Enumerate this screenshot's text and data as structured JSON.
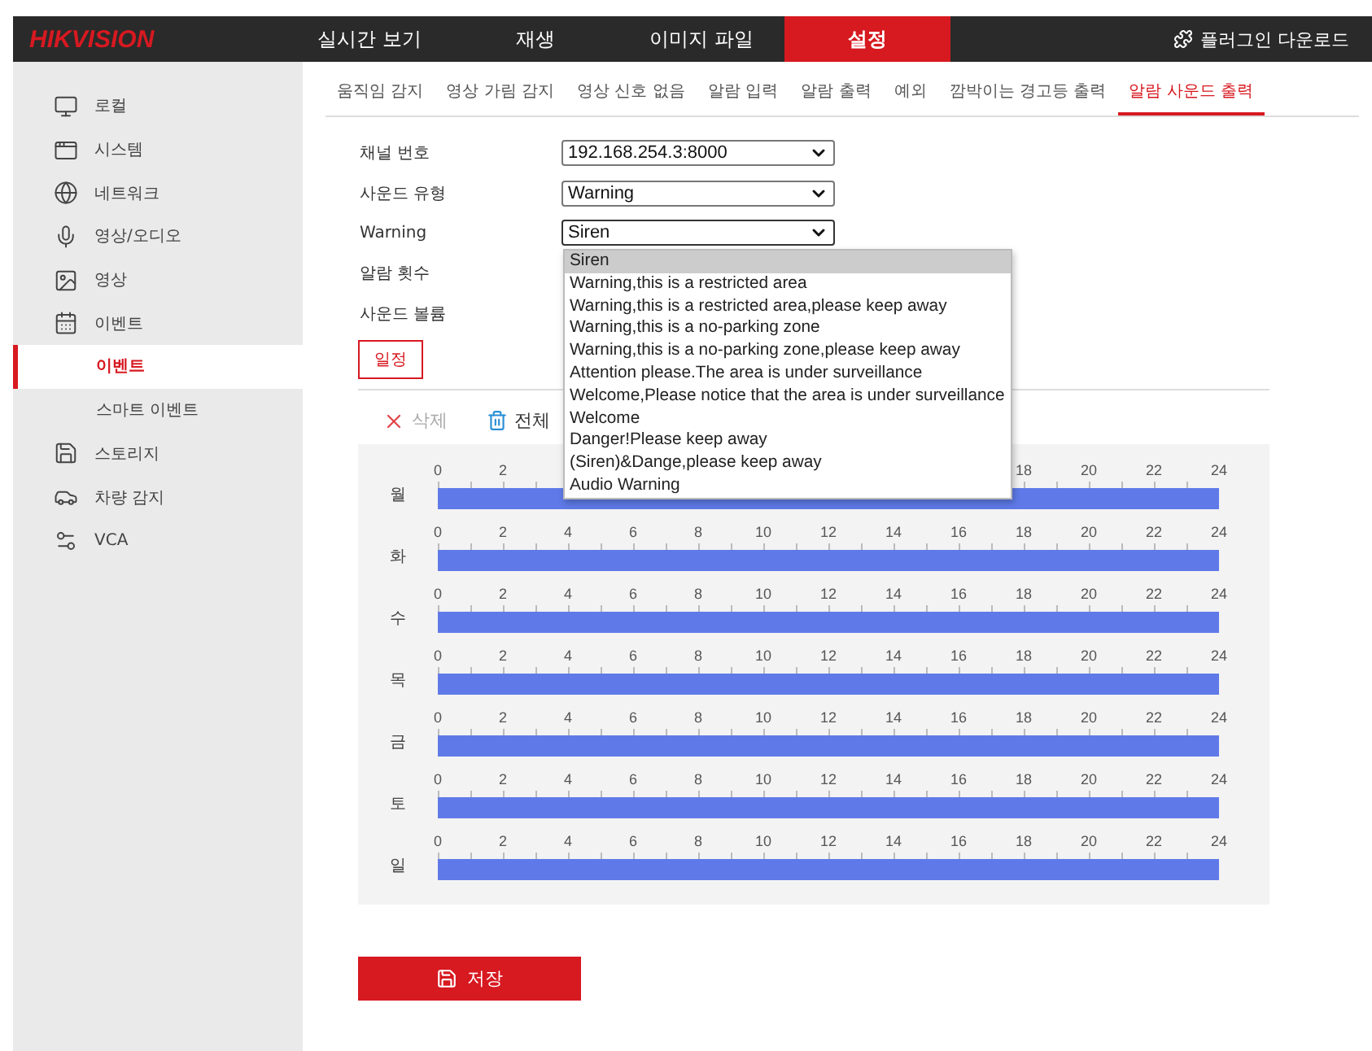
{
  "header": {
    "logo": "HIKVISION",
    "nav": [
      {
        "label": "실시간 보기",
        "selected": false
      },
      {
        "label": "재생",
        "selected": false
      },
      {
        "label": "이미지 파일",
        "selected": false
      },
      {
        "label": "설정",
        "selected": true
      }
    ],
    "plugin": "플러그인 다운로드"
  },
  "sidebar": {
    "items": [
      {
        "label": "로컬",
        "selected": false
      },
      {
        "label": "시스템",
        "selected": false
      },
      {
        "label": "네트워크",
        "selected": false
      },
      {
        "label": "영상/오디오",
        "selected": false
      },
      {
        "label": "영상",
        "selected": false
      },
      {
        "label": "이벤트",
        "selected": false,
        "children": [
          {
            "label": "이벤트",
            "selected": true
          },
          {
            "label": "스마트 이벤트",
            "selected": false
          }
        ]
      },
      {
        "label": "스토리지",
        "selected": false
      },
      {
        "label": "차량 감지",
        "selected": false
      },
      {
        "label": "VCA",
        "selected": false
      }
    ]
  },
  "tabs": [
    {
      "label": "움직임 감지",
      "selected": false
    },
    {
      "label": "영상 가림 감지",
      "selected": false
    },
    {
      "label": "영상 신호 없음",
      "selected": false
    },
    {
      "label": "알람 입력",
      "selected": false
    },
    {
      "label": "알람 출력",
      "selected": false
    },
    {
      "label": "예외",
      "selected": false
    },
    {
      "label": "깜박이는 경고등 출력",
      "selected": false
    },
    {
      "label": "알람 사운드 출력",
      "selected": true
    }
  ],
  "form": [
    {
      "label": "채널 번호",
      "kind": "select",
      "value": "192.168.254.3:8000"
    },
    {
      "label": "사운드 유형",
      "kind": "select",
      "value": "Warning"
    },
    {
      "label": "Warning",
      "kind": "select",
      "value": "Siren",
      "open": true
    },
    {
      "label": "알람 횟수",
      "kind": "hidden"
    },
    {
      "label": "사운드 볼륨",
      "kind": "hidden"
    }
  ],
  "dropdown": [
    {
      "label": "Siren",
      "selected": true
    },
    {
      "label": "Warning,this is a restricted area",
      "selected": false
    },
    {
      "label": "Warning,this is a restricted area,please keep away",
      "selected": false
    },
    {
      "label": "Warning,this is a no-parking zone",
      "selected": false
    },
    {
      "label": "Warning,this is a no-parking zone,please keep away",
      "selected": false
    },
    {
      "label": "Attention please.The area is under surveillance",
      "selected": false
    },
    {
      "label": "Welcome,Please notice that the area is under surveillance",
      "selected": false
    },
    {
      "label": "Welcome",
      "selected": false
    },
    {
      "label": "Danger!Please keep away",
      "selected": false
    },
    {
      "label": "(Siren)&Dange,please keep away",
      "selected": false
    },
    {
      "label": "Audio Warning",
      "selected": false
    }
  ],
  "schedule_tab": "일정",
  "toolbar": [
    {
      "label": "삭제",
      "kind": "delete",
      "disabled": true
    },
    {
      "label": "전체",
      "kind": "delete_all",
      "disabled": false
    }
  ],
  "days": [
    {
      "label": "월",
      "ticks": [
        "0",
        "2",
        "18",
        "20",
        "22",
        "24"
      ]
    },
    {
      "label": "화",
      "ticks": [
        "0",
        "2",
        "4",
        "6",
        "8",
        "10",
        "12",
        "14",
        "16",
        "18",
        "20",
        "22",
        "24"
      ]
    },
    {
      "label": "수",
      "ticks": [
        "0",
        "2",
        "4",
        "6",
        "8",
        "10",
        "12",
        "14",
        "16",
        "18",
        "20",
        "22",
        "24"
      ]
    },
    {
      "label": "목",
      "ticks": [
        "0",
        "2",
        "4",
        "6",
        "8",
        "10",
        "12",
        "14",
        "16",
        "18",
        "20",
        "22",
        "24"
      ]
    },
    {
      "label": "금",
      "ticks": [
        "0",
        "2",
        "4",
        "6",
        "8",
        "10",
        "12",
        "14",
        "16",
        "18",
        "20",
        "22",
        "24"
      ]
    },
    {
      "label": "토",
      "ticks": [
        "0",
        "2",
        "4",
        "6",
        "8",
        "10",
        "12",
        "14",
        "16",
        "18",
        "20",
        "22",
        "24"
      ]
    },
    {
      "label": "일",
      "ticks": [
        "0",
        "2",
        "4",
        "6",
        "8",
        "10",
        "12",
        "14",
        "16",
        "18",
        "20",
        "22",
        "24"
      ]
    }
  ],
  "save_button": "저장"
}
